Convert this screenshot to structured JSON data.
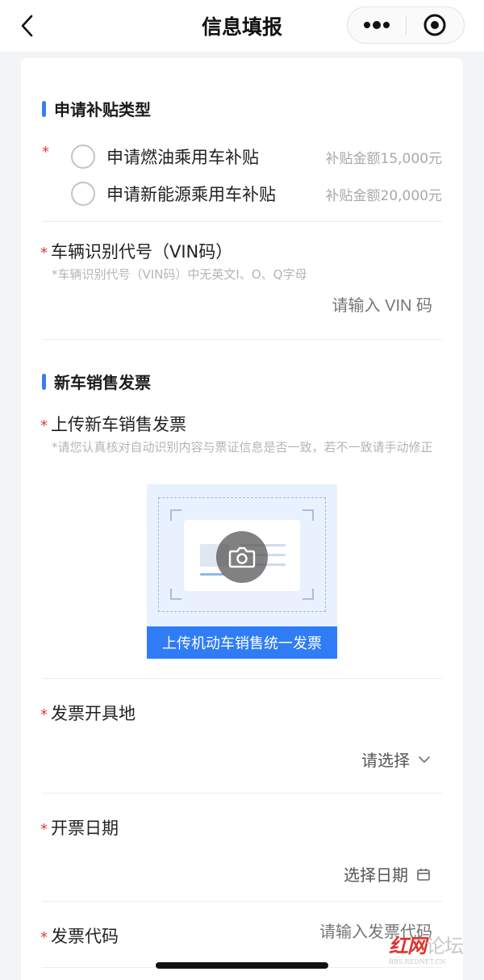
{
  "nav": {
    "title": "信息填报"
  },
  "subsidy": {
    "section_title": "申请补贴类型",
    "required_mark": "*",
    "options": [
      {
        "label": "申请燃油乘用车补贴",
        "amount": "补贴金额15,000元"
      },
      {
        "label": "申请新能源乘用车补贴",
        "amount": "补贴金额20,000元"
      }
    ]
  },
  "vin": {
    "required_mark": "*",
    "label": "车辆识别代号（VIN码）",
    "hint": "*车辆识别代号（VIN码）中无英文I、O、Q字母",
    "placeholder": "请输入 VIN 码"
  },
  "invoice_section": {
    "title": "新车销售发票",
    "upload_label": "上传新车销售发票",
    "required_mark": "*",
    "hint": "*请您认真核对自动识别内容与票证信息是否一致，若不一致请手动修正",
    "upload_button": "上传机动车销售统一发票"
  },
  "invoice_place": {
    "required_mark": "*",
    "label": "发票开具地",
    "select_text": "请选择"
  },
  "invoice_date": {
    "required_mark": "*",
    "label": "开票日期",
    "select_text": "选择日期"
  },
  "invoice_code": {
    "required_mark": "*",
    "label": "发票代码",
    "placeholder": "请输入发票代码"
  },
  "watermark": {
    "brand": "红网",
    "suffix": "论坛",
    "url": "BBS.REDNET.CN"
  },
  "colors": {
    "accent": "#2f7cf6",
    "required": "#e23b3b",
    "placeholder": "#a9a9a9"
  }
}
